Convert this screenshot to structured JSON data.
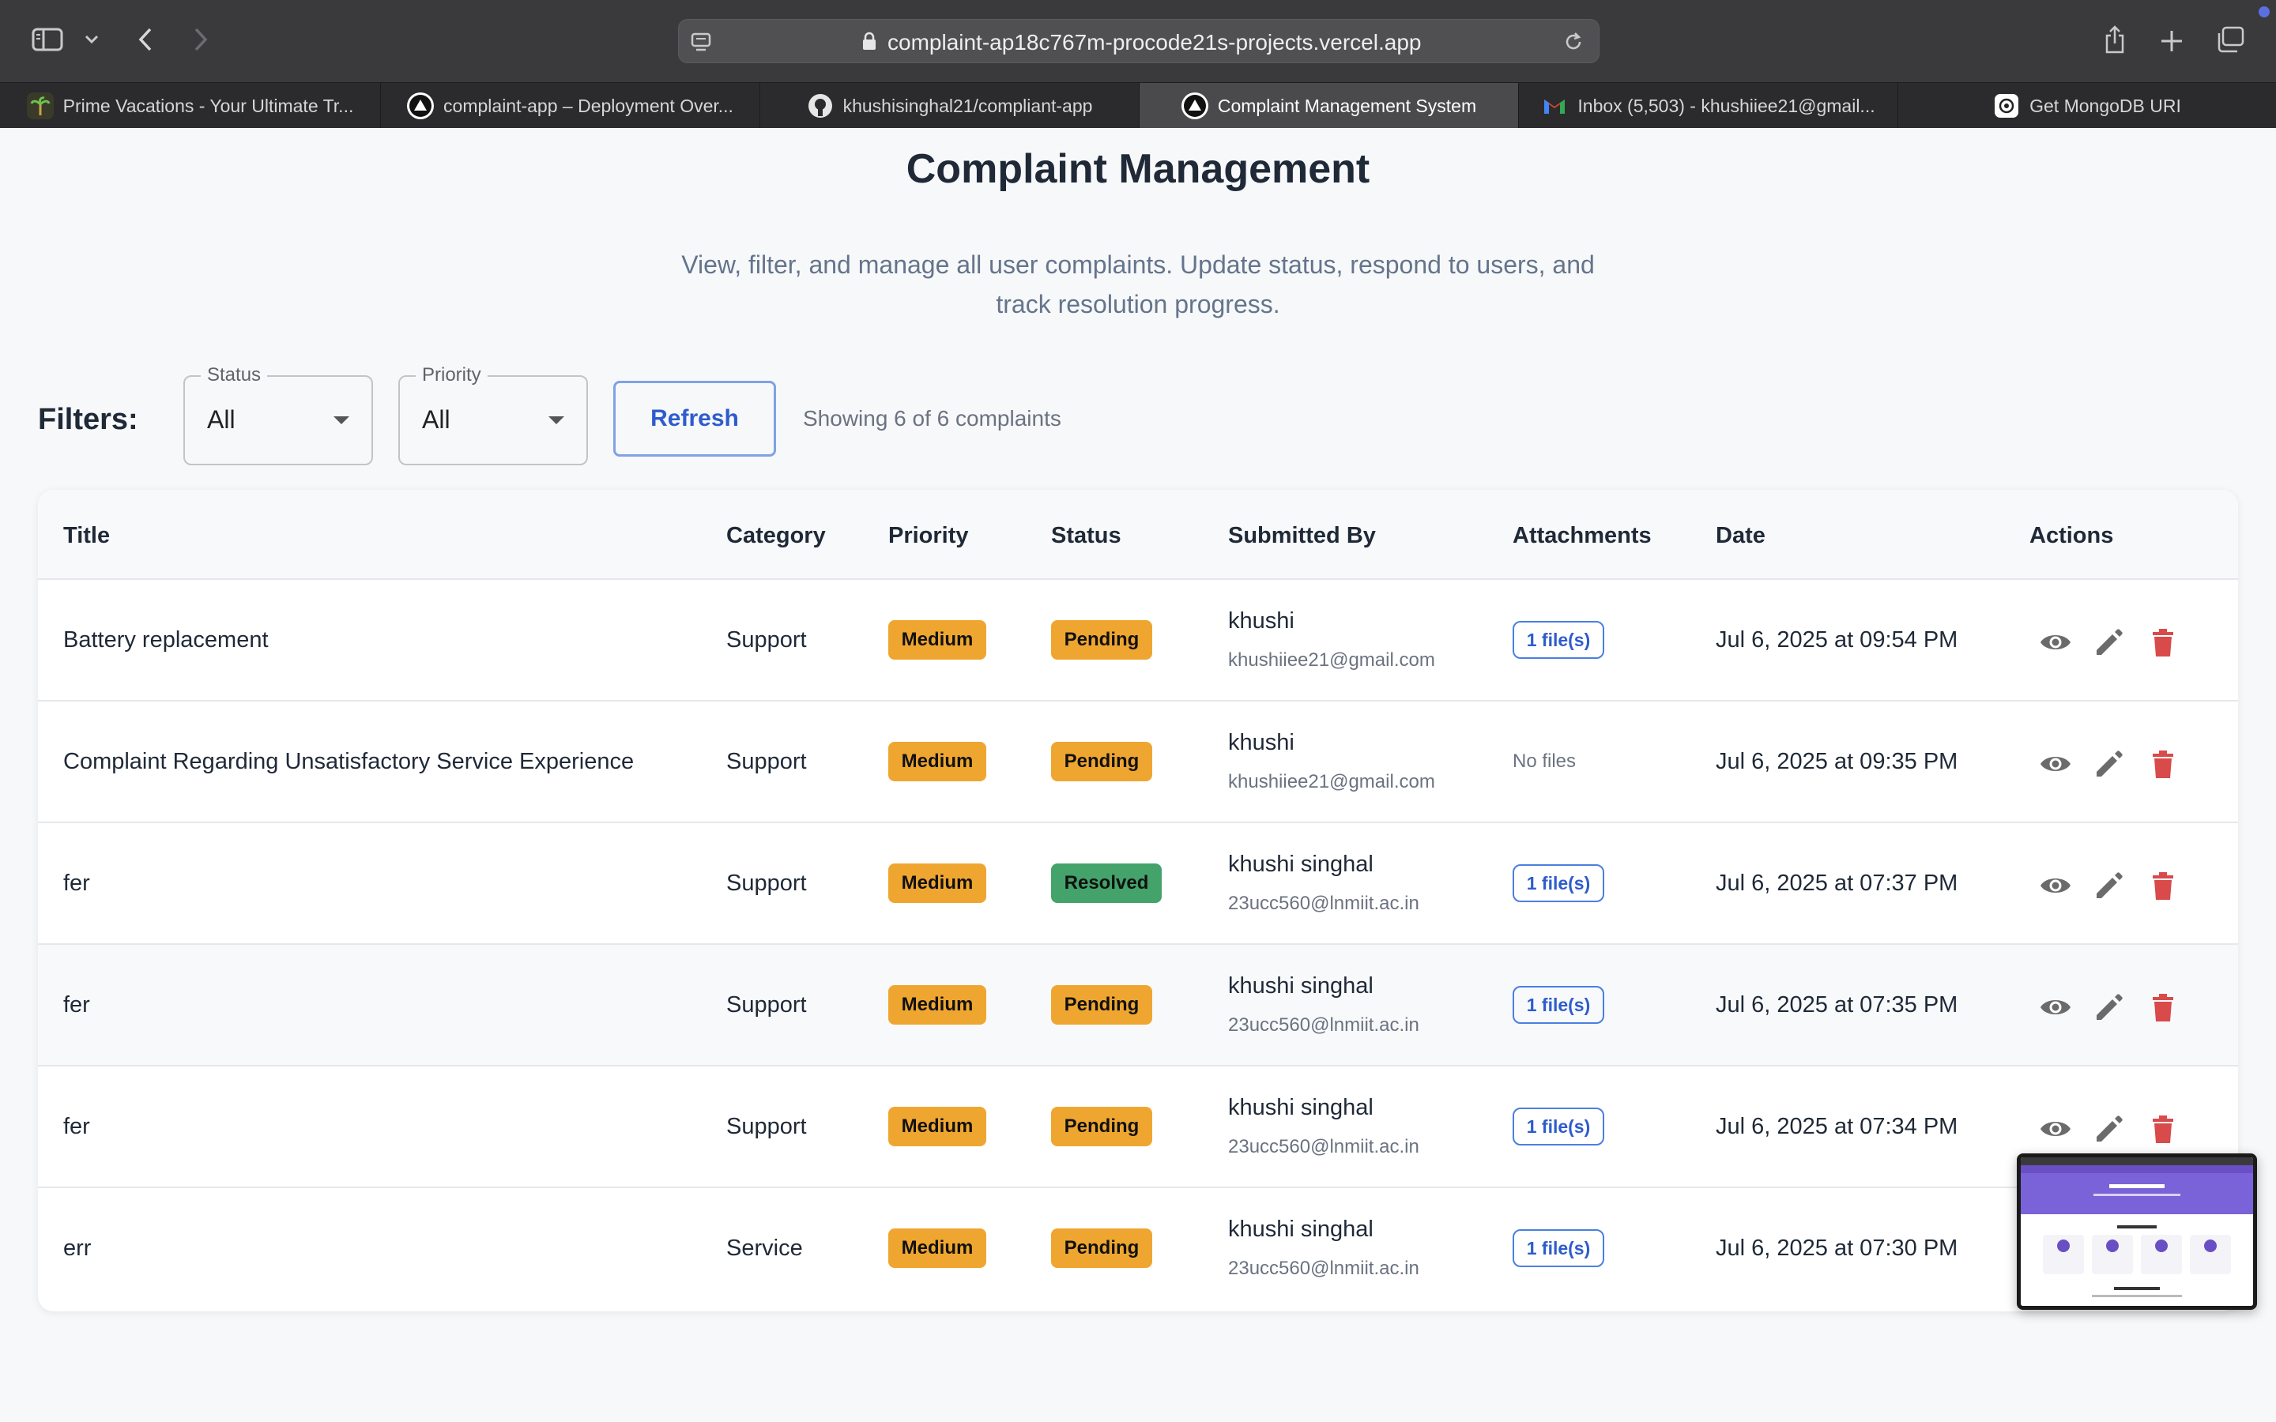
{
  "browser": {
    "url": "complaint-ap18c767m-procode21s-projects.vercel.app",
    "tabs": [
      {
        "label": "Prime Vacations - Your Ultimate Tr..."
      },
      {
        "label": "complaint-app – Deployment Over..."
      },
      {
        "label": "khushisinghal21/compliant-app"
      },
      {
        "label": "Complaint Management System"
      },
      {
        "label": "Inbox (5,503) - khushiiee21@gmail..."
      },
      {
        "label": "Get MongoDB URI"
      }
    ]
  },
  "header": {
    "title": "Complaint Management",
    "subtitle": "View, filter, and manage all user complaints. Update status, respond to users, and track resolution progress."
  },
  "filters": {
    "label": "Filters:",
    "status_label": "Status",
    "status_value": "All",
    "priority_label": "Priority",
    "priority_value": "All",
    "refresh_label": "Refresh",
    "count_text": "Showing 6 of 6 complaints"
  },
  "table": {
    "headers": {
      "title": "Title",
      "category": "Category",
      "priority": "Priority",
      "status": "Status",
      "submitted_by": "Submitted By",
      "attachments": "Attachments",
      "date": "Date",
      "actions": "Actions"
    },
    "rows": [
      {
        "title": "Battery replacement",
        "category": "Support",
        "priority": "Medium",
        "status": "Pending",
        "name": "khushi",
        "email": "khushiiee21@gmail.com",
        "attachments": "1 file(s)",
        "date": "Jul 6, 2025 at 09:54 PM"
      },
      {
        "title": "Complaint Regarding Unsatisfactory Service Experience",
        "category": "Support",
        "priority": "Medium",
        "status": "Pending",
        "name": "khushi",
        "email": "khushiiee21@gmail.com",
        "attachments": "No files",
        "date": "Jul 6, 2025 at 09:35 PM"
      },
      {
        "title": "fer",
        "category": "Support",
        "priority": "Medium",
        "status": "Resolved",
        "name": "khushi singhal",
        "email": "23ucc560@lnmiit.ac.in",
        "attachments": "1 file(s)",
        "date": "Jul 6, 2025 at 07:37 PM"
      },
      {
        "title": "fer",
        "category": "Support",
        "priority": "Medium",
        "status": "Pending",
        "name": "khushi singhal",
        "email": "23ucc560@lnmiit.ac.in",
        "attachments": "1 file(s)",
        "date": "Jul 6, 2025 at 07:35 PM"
      },
      {
        "title": "fer",
        "category": "Support",
        "priority": "Medium",
        "status": "Pending",
        "name": "khushi singhal",
        "email": "23ucc560@lnmiit.ac.in",
        "attachments": "1 file(s)",
        "date": "Jul 6, 2025 at 07:34 PM"
      },
      {
        "title": "err",
        "category": "Service",
        "priority": "Medium",
        "status": "Pending",
        "name": "khushi singhal",
        "email": "23ucc560@lnmiit.ac.in",
        "attachments": "1 file(s)",
        "date": "Jul 6, 2025 at 07:30 PM"
      }
    ]
  },
  "icons": {
    "view": "eye-icon",
    "edit": "pencil-icon",
    "delete": "trash-icon"
  },
  "colors": {
    "medium_badge": "#efa630",
    "pending_badge": "#efa630",
    "resolved_badge": "#43a36b",
    "delete_icon": "#d94a4a",
    "link_blue": "#2e5ccc"
  }
}
